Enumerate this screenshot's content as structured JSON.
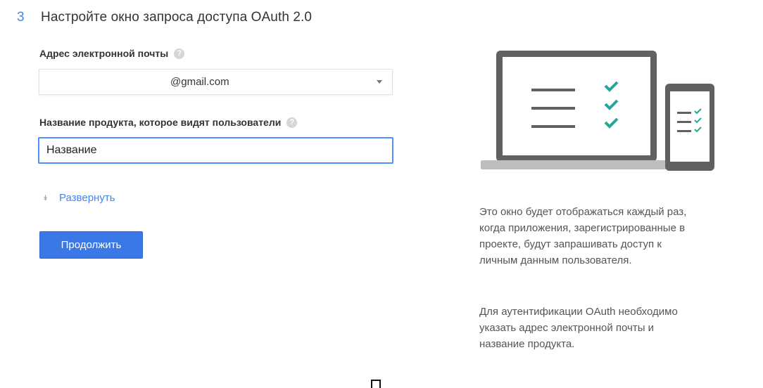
{
  "step": {
    "number": "3",
    "title": "Настройте окно запроса доступа OAuth 2.0"
  },
  "email": {
    "label": "Адрес электронной почты",
    "help_icon": "help-circle-icon",
    "value": "@gmail.com"
  },
  "product_name": {
    "label": "Название продукта, которое видят пользователи",
    "help_icon": "help-circle-icon",
    "value": "Название"
  },
  "expand": {
    "icon": "double-chevron-down-icon",
    "label": "Развернуть"
  },
  "continue_button": {
    "label": "Продолжить"
  },
  "info": {
    "illustration": "laptop-phone-checklist-illustration",
    "paragraph1": [
      "Это окно будет отображаться каждый раз,",
      "когда приложения, зарегистрированные в",
      "проекте, будут запрашивать доступ к",
      "личным данным пользователя."
    ],
    "paragraph2": [
      "Для аутентификации OAuth необходимо",
      "указать адрес электронной почты и",
      "название продукта."
    ]
  },
  "colors": {
    "accent": "#4285f4",
    "button": "#3b78e7",
    "check": "#26a69a",
    "device_frame": "#616161"
  }
}
